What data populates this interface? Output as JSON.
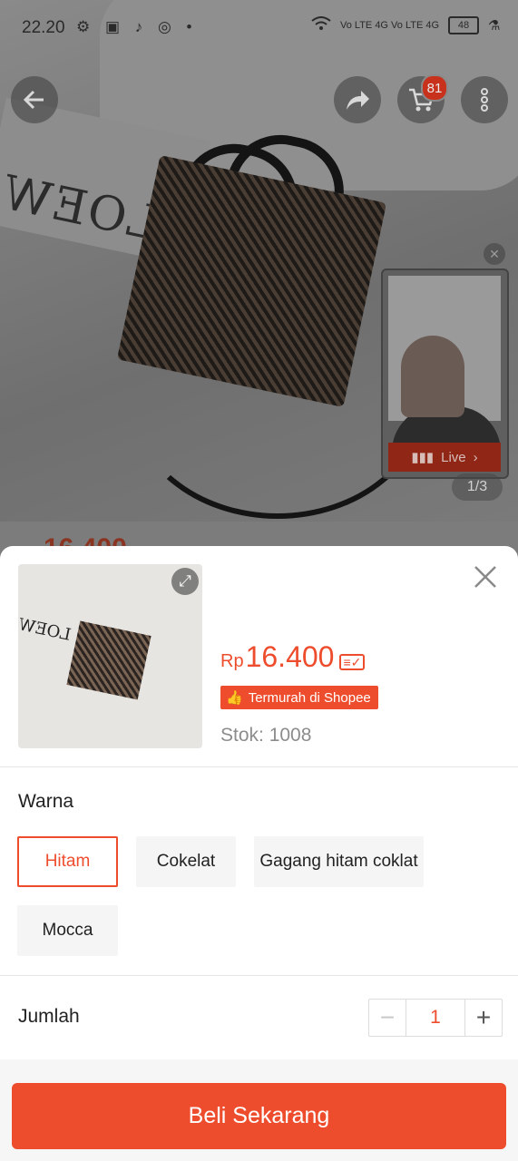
{
  "status_bar": {
    "time": "22.20",
    "left_icons": "⚙ ▣ ♪ ◎ •",
    "signal_text": "Vo LTE 4G  Vo LTE 4G",
    "battery": "48"
  },
  "top_nav": {
    "back_icon": "arrow-left-icon",
    "share_icon": "share-icon",
    "cart_icon": "cart-icon",
    "cart_count": "81",
    "more_icon": "more-vertical-icon"
  },
  "live_pip": {
    "label": "Live",
    "close_icon": "close-icon"
  },
  "image_pager": "1/3",
  "background_price": "16.400",
  "product": {
    "image_text": "LOEW",
    "price_currency": "Rp",
    "price_value": "16.400",
    "price_tag": "≡✓",
    "promo_label": "Termurah di Shopee",
    "stock": "Stok: 1008"
  },
  "variation": {
    "title": "Warna",
    "options": [
      {
        "label": "Hitam",
        "selected": true
      },
      {
        "label": "Cokelat",
        "selected": false
      },
      {
        "label": "Gagang hitam coklat",
        "selected": false
      },
      {
        "label": "Mocca",
        "selected": false
      }
    ]
  },
  "quantity": {
    "title": "Jumlah",
    "value": "1",
    "minus": "−",
    "plus": "+"
  },
  "buy_button": "Beli Sekarang",
  "colors": {
    "accent": "#ee4d2d"
  }
}
